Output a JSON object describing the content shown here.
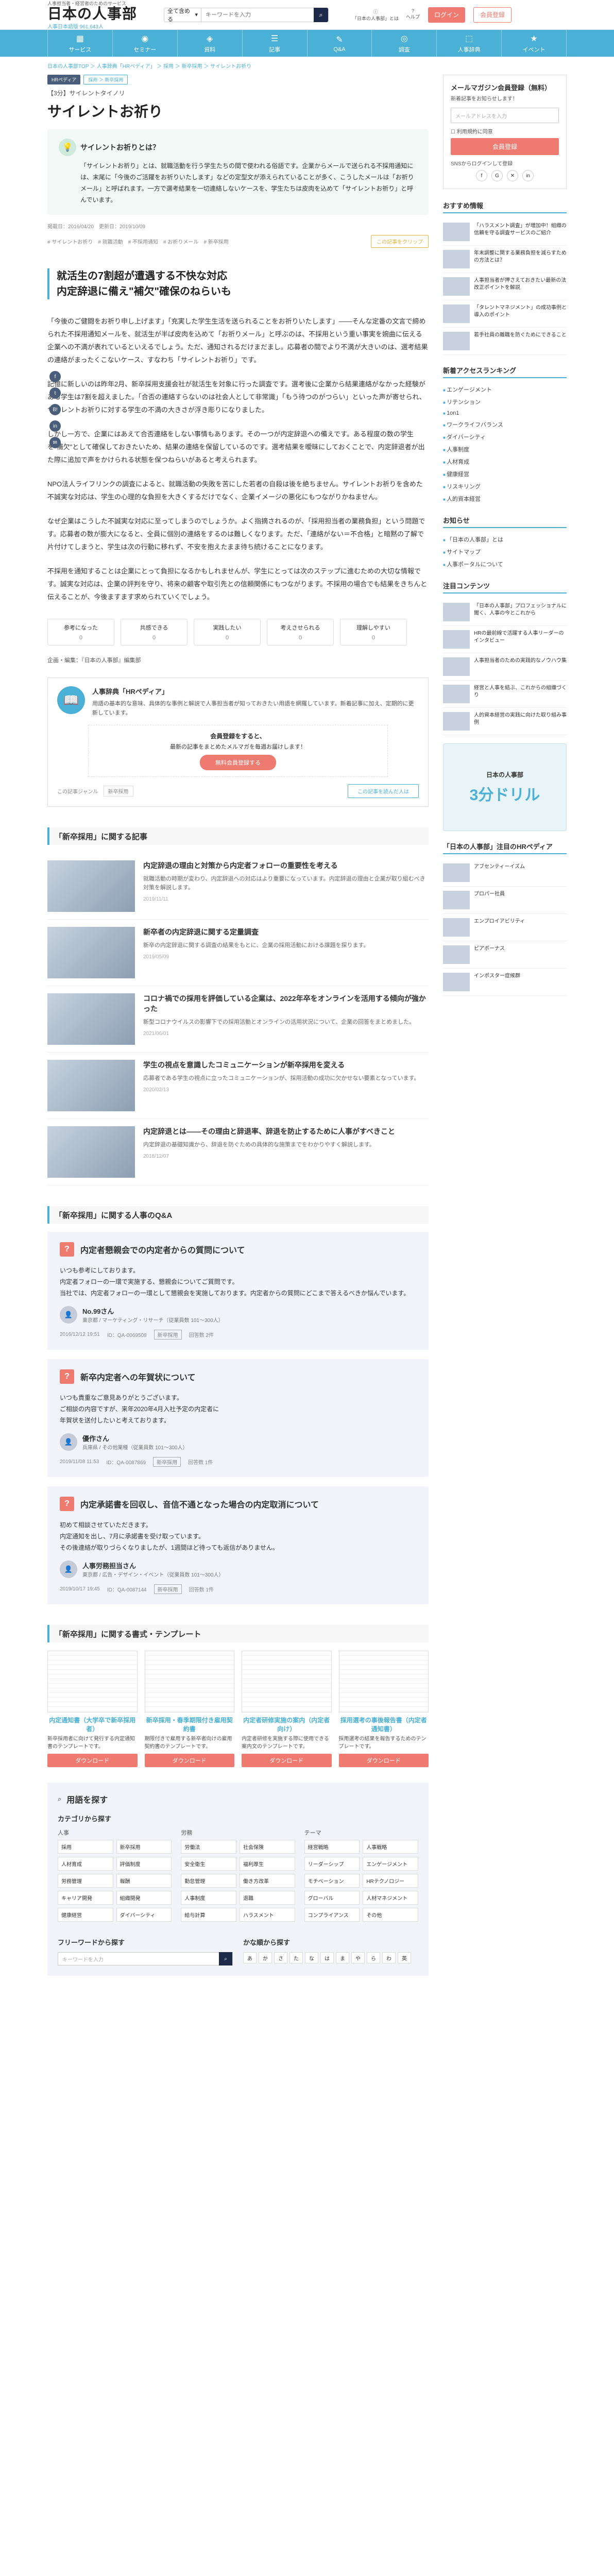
{
  "header": {
    "logo_sub": "人事担当者・経営者のためのサービス",
    "logo_main": "日本の人事部",
    "logo_count": "人事日本語版 961,643人",
    "search_select": "全て含める",
    "search_placeholder": "キーワードを入力",
    "icons": [
      "「日本の人事部」とは",
      "ヘルプ"
    ],
    "login": "ログイン",
    "register": "会員登録"
  },
  "nav": [
    {
      "icon": "▦",
      "label": "サービス"
    },
    {
      "icon": "◉",
      "label": "セミナー"
    },
    {
      "icon": "◈",
      "label": "資料"
    },
    {
      "icon": "☰",
      "label": "記事"
    },
    {
      "icon": "✎",
      "label": "Q&A"
    },
    {
      "icon": "◎",
      "label": "調査"
    },
    {
      "icon": "⬚",
      "label": "人事辞典"
    },
    {
      "icon": "★",
      "label": "イベント"
    }
  ],
  "breadcrumb": "日本の人事部TOP ＞ 人事辞典「HRペディア」 ＞ 採用 ＞ 新卒採用 ＞ サイレントお祈り",
  "article": {
    "tag_dark": "HRペディア",
    "tag_light": "採用 ＞ 新卒採用",
    "series": "【3分】サイレントタイノリ",
    "title": "サイレントお祈り",
    "summary_head": "サイレントお祈りとは？",
    "summary": "「サイレントお祈り」とは、就職活動を行う学生たちの間で使われる俗語です。企業からメールで送られる不採用通知には、末尾に「今後のご活躍をお祈りいたします」などの定型文が添えられていることが多く、こうしたメールは「お祈りメール」と呼ばれます。一方で選考結果を一切連絡しないケースを、学生たちは皮肉を込めて「サイレントお祈り」と呼んでいます。",
    "meta": "掲載日：2016/04/20　更新日：2019/10/09",
    "keywords": [
      "サイレントお祈り",
      "就職活動",
      "不採用通知",
      "お祈りメール",
      "新卒採用"
    ],
    "clip": "この記事をクリップ",
    "lead": "就活生の7割超が遭遇する不快な対応\n内定辞退に備え\"補欠\"確保のねらいも",
    "paragraphs": [
      "「今後のご健闘をお祈り申し上げます」「充実した学生生活を送られることをお祈りいたします」――そんな定番の文言で締められた不採用通知メールを、就活生が半ば皮肉を込めて「お祈りメール」と呼ぶのは、不採用という重い事実を婉曲に伝える企業への不満が表れているといえるでしょう。ただ、通知されるだけまだまし。応募者の間でより不満が大きいのは、選考結果の連絡がまったくこないケース、すなわち「サイレントお祈り」です。",
      "記憶に新しいのは昨年2月、新卒採用支援会社が就活生を対象に行った調査です。選考後に企業から結果連絡がなかった経験がある学生は7割を超えました。「合否の連絡すらないのは社会人として非常識」「もう待つのがつらい」といった声が寄せられ、サイレントお祈りに対する学生の不満の大きさが浮き彫りになりました。",
      "しかし一方で、企業にはあえて合否連絡をしない事情もあります。その一つが内定辞退への備えです。ある程度の数の学生を\"補欠\"として確保しておきたいため、結果の連絡を保留しているのです。選考結果を曖昧にしておくことで、内定辞退者が出た際に追加で声をかけられる状態を保つねらいがあると考えられます。",
      "NPO法人ライフリンクの調査によると、就職活動の失敗を苦にした若者の自殺は後を絶ちません。サイレントお祈りを含めた不誠実な対応は、学生の心理的な負担を大きくするだけでなく、企業イメージの悪化にもつながりかねません。",
      "なぜ企業はこうした不誠実な対応に至ってしまうのでしょうか。よく指摘されるのが、「採用担当者の業務負担」という問題です。応募者の数が膨大になると、全員に個別の連絡をするのは難しくなります。ただ、「連絡がない＝不合格」と暗黙の了解で片付けてしまうと、学生は次の行動に移れず、不安を抱えたまま待ち続けることになります。",
      "不採用を通知することは企業にとって負担になるかもしれませんが、学生にとっては次のステップに進むための大切な情報です。誠実な対応は、企業の評判を守り、将来の顧客や取引先との信頼関係にもつながります。不採用の場合でも結果をきちんと伝えることが、今後ますます求められていくでしょう。"
    ],
    "reactions": [
      {
        "label": "参考になった",
        "count": "0"
      },
      {
        "label": "共感できる",
        "count": "0"
      },
      {
        "label": "実践したい",
        "count": "0"
      },
      {
        "label": "考えさせられる",
        "count": "0"
      },
      {
        "label": "理解しやすい",
        "count": "0"
      }
    ],
    "author": "企画・編集：『日本の人事部』編集部"
  },
  "share": [
    "f",
    "t",
    "B!",
    "in",
    "✉"
  ],
  "hrwiki": {
    "title": "人事辞典「HRペディア」",
    "text": "用語の基本的な意味、具体的な事例と解説で人事担当者が知っておきたい用語を網羅しています。新着記事に加え、定期的に更新しています。",
    "cta_title": "会員登録をすると、",
    "cta_text": "最新の記事をまとめたメルマガを毎週お届けします！",
    "cta_btn": "無料会員登録する",
    "foot_label": "この記事ジャンル",
    "foot_kw": "新卒採用",
    "foot_link": "この記事を読んだ人は"
  },
  "related": {
    "heading": "「新卒採用」に関する記事",
    "items": [
      {
        "title": "内定辞退の理由と対策から内定者フォローの重要性を考える",
        "text": "就職活動の時期が変わり、内定辞退への対応はより重要になっています。内定辞退の理由と企業が取り組むべき対策を解説します。",
        "date": "2019/11/11"
      },
      {
        "title": "新卒者の内定辞退に関する定量調査",
        "text": "新卒の内定辞退に関する調査の結果をもとに、企業の採用活動における課題を探ります。",
        "date": "2019/05/09"
      },
      {
        "title": "コロナ禍での採用を評価している企業は、2022年卒をオンラインを活用する傾向が強かった",
        "text": "新型コロナウイルスの影響下での採用活動とオンラインの活用状況について、企業の回答をまとめました。",
        "date": "2021/06/01"
      },
      {
        "title": "学生の視点を意識したコミュニケーションが新卒採用を変える",
        "text": "応募者である学生の視点に立ったコミュニケーションが、採用活動の成功に欠かせない要素となっています。",
        "date": "2020/02/13"
      },
      {
        "title": "内定辞退とは――その理由と辞退率、辞退を防止するために人事がすべきこと",
        "text": "内定辞退の基礎知識から、辞退を防ぐための具体的な施策までをわかりやすく解説します。",
        "date": "2018/12/07"
      }
    ]
  },
  "qa": {
    "heading": "「新卒採用」に関する人事のQ&A",
    "items": [
      {
        "title": "内定者懇親会での内定者からの質問について",
        "body": "いつも参考にしております。\n内定者フォローの一環で実施する、懇親会についてご質問です。\n当社では、内定者フォローの一環として懇親会を実施しております。内定者からの質問にどこまで答えるべきか悩んでいます。",
        "name": "No.99さん",
        "role": "東京都 / マーケティング・リサーチ（従業員数 101～300人）",
        "date": "2016/12/12 19:51",
        "id": "ID：QA-0069508",
        "cat": "新卒採用",
        "answers": "回答数 2件"
      },
      {
        "title": "新卒内定者への年賀状について",
        "body": "いつも貴重なご意見ありがとうございます。\nご相談の内容ですが、来年2020年4月入社予定の内定者に\n年賀状を送付したいと考えております。",
        "name": "優作さん",
        "role": "兵庫県 / その他業種（従業員数 101～300人）",
        "date": "2019/11/08 11:53",
        "id": "ID：QA-0087869",
        "cat": "新卒採用",
        "answers": "回答数 1件"
      },
      {
        "title": "内定承諾書を回収し、音信不通となった場合の内定取消について",
        "body": "初めて相談させていただきます。\n内定通知を出し、7月に承諾書を受け取っています。\nその後連絡が取りづらくなりましたが、1週間ほど待っても返信がありません。",
        "name": "人事労務担当さん",
        "role": "東京都 / 広告・デザイン・イベント（従業員数 101～300人）",
        "date": "2019/10/17 19:45",
        "id": "ID：QA-0087144",
        "cat": "新卒採用",
        "answers": "回答数 1件"
      }
    ]
  },
  "templates": {
    "heading": "「新卒採用」に関する書式・テンプレート",
    "items": [
      {
        "title": "内定通知書（大学卒で新卒採用者）",
        "text": "新卒採用者に向けて発行する内定通知書のテンプレートです。",
        "btn": "ダウンロード"
      },
      {
        "title": "新卒採用・春季期限付き雇用契約書",
        "text": "期限付きで雇用する新卒者向けの雇用契約書のテンプレートです。",
        "btn": "ダウンロード"
      },
      {
        "title": "内定者研修実施の案内（内定者向け）",
        "text": "内定者研修を実施する際に使用できる案内文のテンプレートです。",
        "btn": "ダウンロード"
      },
      {
        "title": "採用選考の事後報告書（内定者通知書）",
        "text": "採用選考の結果を報告するためのテンプレートです。",
        "btn": "ダウンロード"
      }
    ]
  },
  "glossary": {
    "title": "用語を探す",
    "cat_title": "カテゴリから探す",
    "cols": [
      {
        "head": "人事",
        "cells": [
          "採用",
          "新卒採用",
          "人材育成",
          "評価制度",
          "労務管理",
          "報酬",
          "キャリア開発",
          "組織開発",
          "健康経営",
          "ダイバーシティ"
        ]
      },
      {
        "head": "労務",
        "cells": [
          "労働法",
          "社会保険",
          "安全衛生",
          "福利厚生",
          "勤怠管理",
          "働き方改革",
          "人事制度",
          "退職",
          "給与計算",
          "ハラスメント"
        ]
      },
      {
        "head": "テーマ",
        "cells": [
          "経営戦略",
          "人事戦略",
          "リーダーシップ",
          "エンゲージメント",
          "モチベーション",
          "HRテクノロジー",
          "グローバル",
          "人材マネジメント",
          "コンプライアンス",
          "その他"
        ]
      }
    ],
    "freeword_title": "フリーワードから探す",
    "freeword_placeholder": "キーワードを入力",
    "kana_title": "かな順から探す",
    "kana": [
      "あ",
      "か",
      "さ",
      "た",
      "な",
      "は",
      "ま",
      "や",
      "ら",
      "わ",
      "英"
    ]
  },
  "sidebar": {
    "mm_title": "メールマガジン会員登録（無料）",
    "mm_text": "新着記事をお知らせします！",
    "mm_placeholder": "メールアドレスを入力",
    "mm_check1": "利用規約に同意",
    "mm_btn": "会員登録",
    "mm_check2": "SNSからログインして登録",
    "social": [
      "f",
      "G",
      "✕",
      "in"
    ],
    "reco_head": "おすすめ情報",
    "reco": [
      {
        "text": "「ハラスメント調査」が増加中！組織の信頼を守る調査サービスのご紹介"
      },
      {
        "text": "年末調整に関する業務負担を減らすための方法とは？"
      },
      {
        "text": "人事担当者が押さえておきたい最新の法改正ポイントを解説"
      },
      {
        "text": "「タレントマネジメント」の成功事例と導入のポイント"
      },
      {
        "text": "若手社員の離職を防ぐためにできること"
      }
    ],
    "ranking_head": "新着アクセスランキング",
    "ranking": [
      "エンゲージメント",
      "リテンション",
      "1on1",
      "ワークライフバランス",
      "ダイバーシティ",
      "人事制度",
      "人材育成",
      "健康経営",
      "リスキリング",
      "人的資本経営"
    ],
    "news_head": "お知らせ",
    "news": [
      "「日本の人事部」とは",
      "サイトマップ",
      "人事ポータルについて"
    ],
    "content_head": "注目コンテンツ",
    "content": [
      {
        "text": "「日本の人事部」プロフェッショナルに聞く、人事の今とこれから"
      },
      {
        "text": "HRの最前線で活躍する人事リーダーのインタビュー"
      },
      {
        "text": "人事担当者のための実践的なノウハウ集"
      },
      {
        "text": "経営と人事を結ぶ、これからの組織づくり"
      },
      {
        "text": "人的資本経営の実践に向けた取り組み事例"
      }
    ],
    "banner_sub": "日本の人事部",
    "banner_main": "3分ドリル",
    "hrpedia_head": "「日本の人事部」注目のHRペディア",
    "hrpedia": [
      {
        "text": "アブセンティーイズム"
      },
      {
        "text": "プロパー社員"
      },
      {
        "text": "エンプロイアビリティ"
      },
      {
        "text": "ピアボーナス"
      },
      {
        "text": "インポスター症候群"
      }
    ]
  }
}
